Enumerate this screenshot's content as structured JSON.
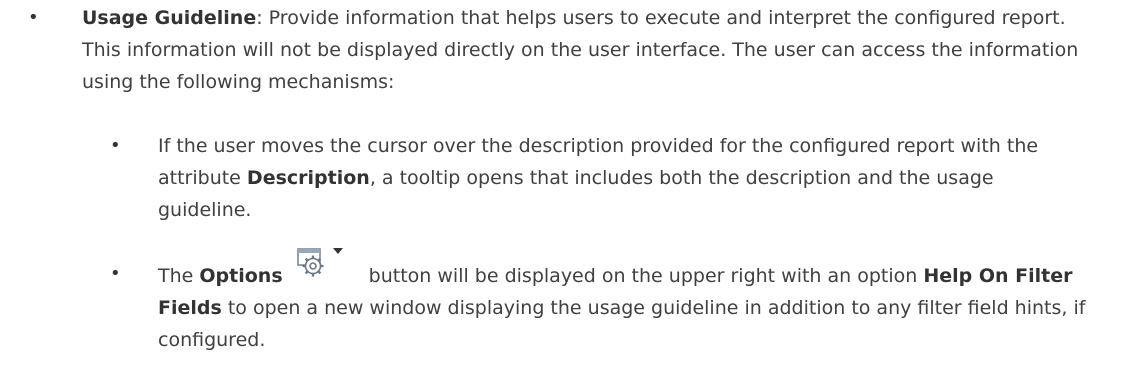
{
  "guideline": {
    "term": "Usage Guideline",
    "text": ": Provide information that helps users to execute and interpret the configured report. This information will not be displayed directly on the user interface. The user can access the information using the following mechanisms:"
  },
  "sub1": {
    "pre": "If the user moves the cursor over the description provided for the configured report with the attribute ",
    "bold": "Description",
    "post": ", a tooltip opens that includes both the description and the usage guideline."
  },
  "sub2": {
    "pre": "The ",
    "bold1": "Options",
    "mid": " button will be displayed on the upper right with an option ",
    "bold2": "Help On Filter Fields",
    "post": " to open a new window displaying the usage guideline in addition to any filter field hints, if configured.",
    "icon": "options-gear-dropdown-icon"
  },
  "bullet_char": "•"
}
